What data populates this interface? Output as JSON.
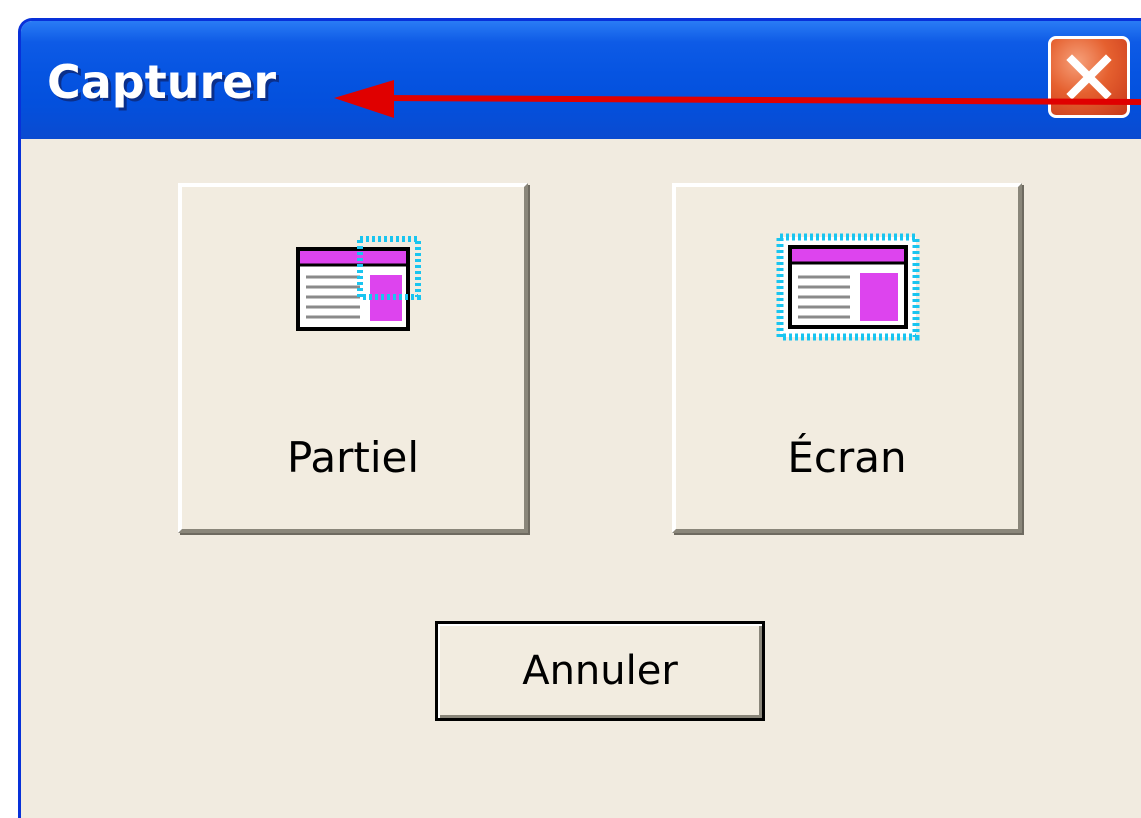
{
  "window": {
    "title": "Capturer",
    "close_icon": "close-icon"
  },
  "buttons": {
    "partial": {
      "label": "Partiel",
      "icon": "partial-capture-icon"
    },
    "screen": {
      "label": "Écran",
      "icon": "screen-capture-icon"
    },
    "cancel": {
      "label": "Annuler"
    }
  },
  "annotation": {
    "icon": "red-arrow-icon",
    "color": "#e00000"
  },
  "colors": {
    "titlebar": "#0654e1",
    "close_button": "#e5602f",
    "dialog_background": "#f1ebe0",
    "icon_accent": "#dd44ee",
    "selection_dots": "#19c5f0"
  }
}
